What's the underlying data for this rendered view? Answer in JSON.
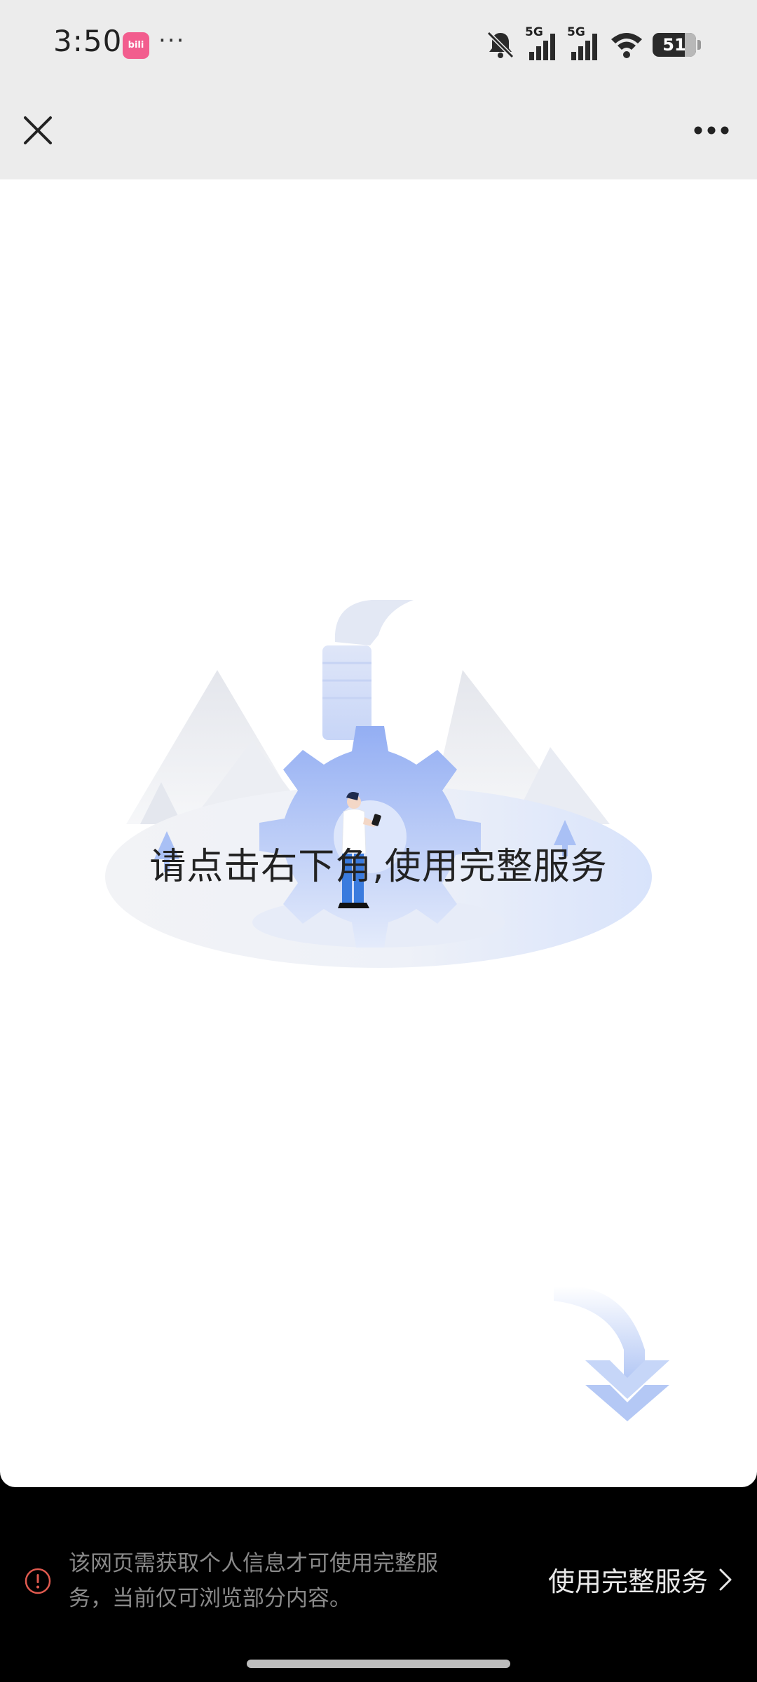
{
  "status_bar": {
    "time": "3:50",
    "app_badge": "bili",
    "more_dots": "···",
    "network_1": "5G",
    "network_2": "5G",
    "battery": "51"
  },
  "nav": {
    "close_icon": "close-icon",
    "more_icon": "more-horizontal-icon"
  },
  "content": {
    "message": "请点击右下角,使用完整服务",
    "illustration_icon": "factory-gear-illustration",
    "arrow_icon": "curved-down-arrow-icon"
  },
  "notice": {
    "text": "该网页需获取个人信息才可使用完整服务，当前仅可浏览部分内容。",
    "action_label": "使用完整服务",
    "warning_color": "#e05a4f"
  },
  "colors": {
    "accent_blue": "#a9c0f5",
    "nav_background": "#ececec"
  }
}
